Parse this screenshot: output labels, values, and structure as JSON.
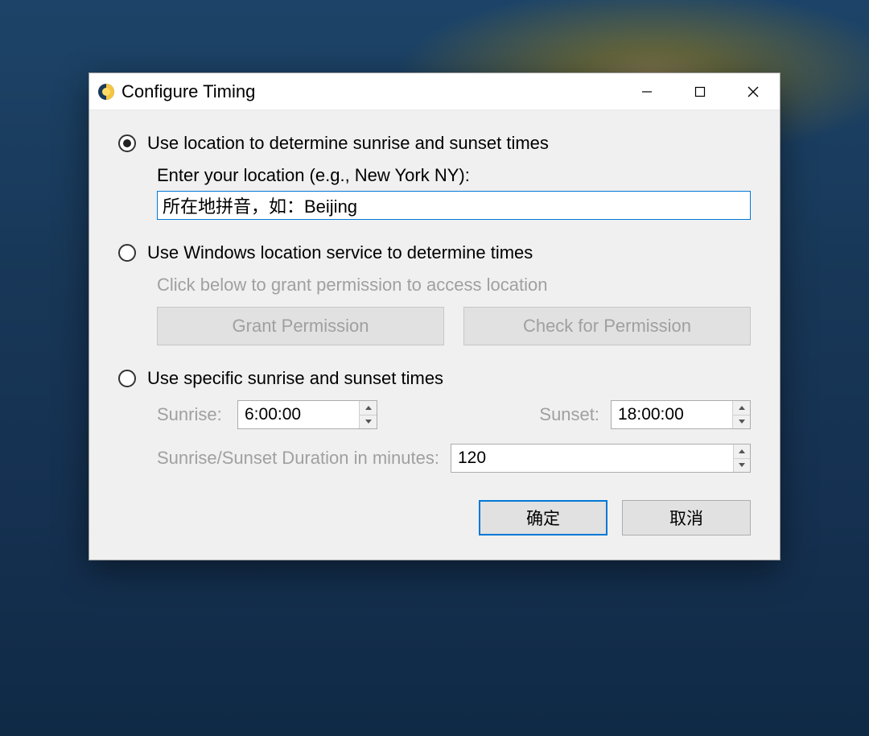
{
  "window": {
    "title": "Configure Timing"
  },
  "option1": {
    "label": "Use location to determine sunrise and sunset times",
    "field_label": "Enter your location (e.g., New York NY):",
    "input_value": "所在地拼音，如：Beijing"
  },
  "option2": {
    "label": "Use Windows location service to determine times",
    "hint": "Click below to grant permission to access location",
    "grant_btn": "Grant Permission",
    "check_btn": "Check for Permission"
  },
  "option3": {
    "label": "Use specific sunrise and sunset times",
    "sunrise_label": "Sunrise:",
    "sunrise_value": "6:00:00",
    "sunset_label": "Sunset:",
    "sunset_value": "18:00:00",
    "duration_label": "Sunrise/Sunset Duration in minutes:",
    "duration_value": "120"
  },
  "buttons": {
    "ok": "确定",
    "cancel": "取消"
  }
}
